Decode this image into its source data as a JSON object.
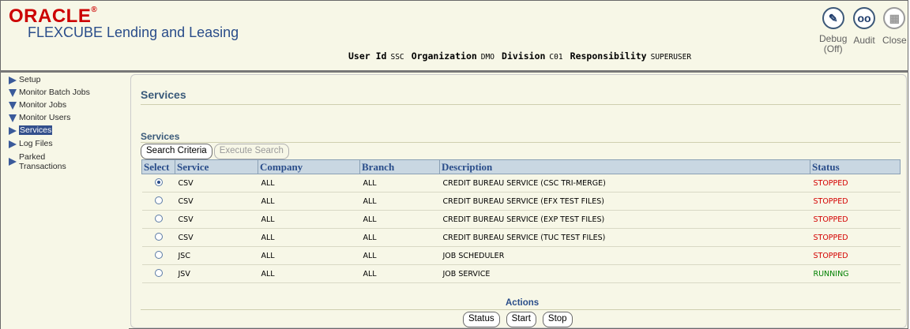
{
  "header": {
    "brand": "ORACLE",
    "brand_mark": "®",
    "product": "FLEXCUBE Lending and Leasing",
    "user": [
      {
        "label": "User Id",
        "value": "SSC"
      },
      {
        "label": "Organization",
        "value": "DMO"
      },
      {
        "label": "Division",
        "value": "C01"
      },
      {
        "label": "Responsibility",
        "value": "SUPERUSER"
      }
    ],
    "global_buttons": [
      {
        "label": "Debug",
        "sublabel": "(Off)",
        "icon": "pencil-icon"
      },
      {
        "label": "Audit",
        "icon": "glasses-icon"
      },
      {
        "label": "Close",
        "icon": "close-doc-icon"
      }
    ]
  },
  "sidebar": {
    "items": [
      {
        "label": "Setup",
        "state": "collapsed"
      },
      {
        "label": "Monitor Batch Jobs",
        "state": "expanded"
      },
      {
        "label": "Monitor Jobs",
        "state": "expanded"
      },
      {
        "label": "Monitor Users",
        "state": "expanded"
      },
      {
        "label": "Services",
        "state": "collapsed",
        "active": true
      },
      {
        "label": "Log Files",
        "state": "collapsed"
      },
      {
        "label": "Parked",
        "label2": "Transactions",
        "state": "collapsed"
      }
    ]
  },
  "main": {
    "page_title": "Services",
    "section_title": "Services",
    "buttons": {
      "search_criteria": "Search Criteria",
      "execute_search": "Execute Search"
    },
    "columns": [
      "Select",
      "Service",
      "Company",
      "Branch",
      "Description",
      "Status"
    ],
    "rows": [
      {
        "selected": true,
        "service": "CSV",
        "company": "ALL",
        "branch": "ALL",
        "description": "CREDIT BUREAU SERVICE (CSC TRI-MERGE)",
        "status": "STOPPED"
      },
      {
        "selected": false,
        "service": "CSV",
        "company": "ALL",
        "branch": "ALL",
        "description": "CREDIT BUREAU SERVICE (EFX TEST FILES)",
        "status": "STOPPED"
      },
      {
        "selected": false,
        "service": "CSV",
        "company": "ALL",
        "branch": "ALL",
        "description": "CREDIT BUREAU SERVICE (EXP TEST FILES)",
        "status": "STOPPED"
      },
      {
        "selected": false,
        "service": "CSV",
        "company": "ALL",
        "branch": "ALL",
        "description": "CREDIT BUREAU SERVICE (TUC TEST FILES)",
        "status": "STOPPED"
      },
      {
        "selected": false,
        "service": "JSC",
        "company": "ALL",
        "branch": "ALL",
        "description": "JOB SCHEDULER",
        "status": "STOPPED"
      },
      {
        "selected": false,
        "service": "JSV",
        "company": "ALL",
        "branch": "ALL",
        "description": "JOB SERVICE",
        "status": "RUNNING"
      }
    ],
    "actions_title": "Actions",
    "actions": {
      "status": "Status",
      "start": "Start",
      "stop": "Stop"
    }
  },
  "colors": {
    "brand_red": "#cc0000",
    "header_blue": "#2a4d8a",
    "background": "#f7f7e7",
    "table_header": "#c9d7e2",
    "stopped": "#d40000",
    "running": "#008000"
  }
}
